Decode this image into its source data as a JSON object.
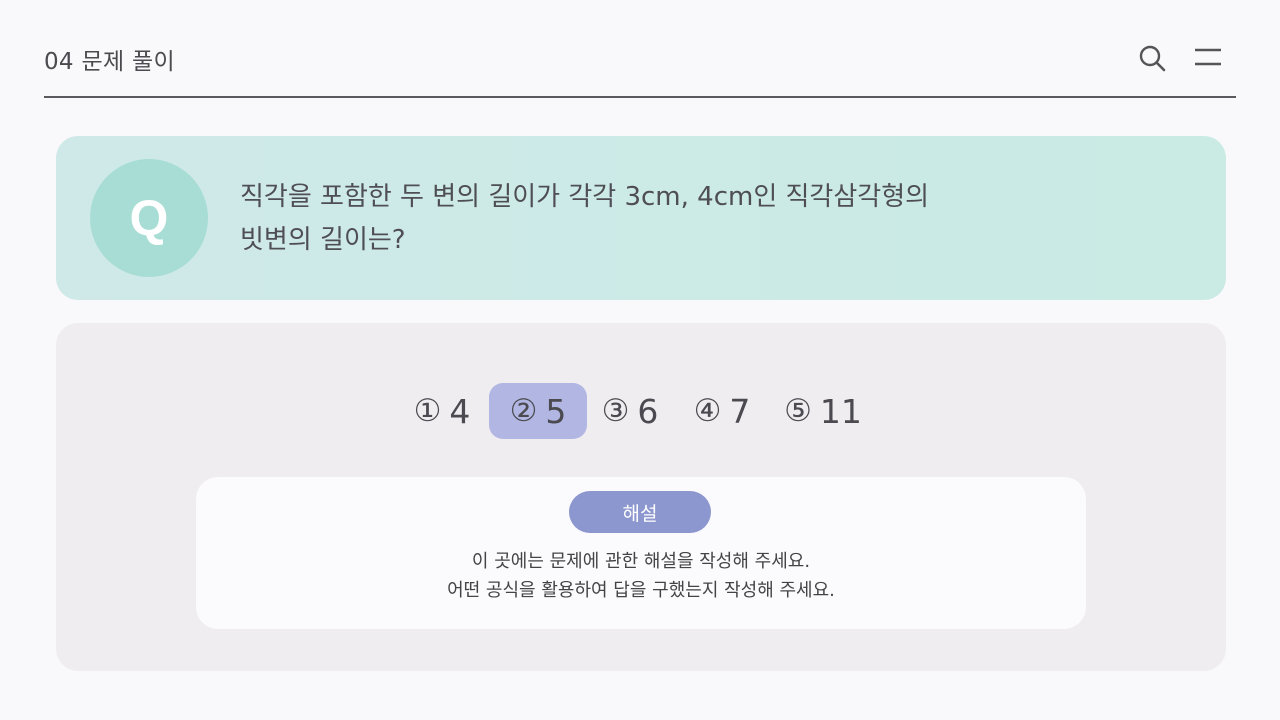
{
  "header": {
    "title": "04 문제 풀이",
    "search_icon": "search-icon",
    "menu_icon": "menu-icon"
  },
  "question": {
    "badge": "Q",
    "line1": "직각을 포함한 두 변의 길이가 각각 3cm, 4cm인 직각삼각형의",
    "line2": "빗변의 길이는?"
  },
  "choices": [
    {
      "marker": "①",
      "value": "4",
      "selected": false
    },
    {
      "marker": "②",
      "value": "5",
      "selected": true
    },
    {
      "marker": "③",
      "value": "6",
      "selected": false
    },
    {
      "marker": "④",
      "value": "7",
      "selected": false
    },
    {
      "marker": "⑤",
      "value": "11",
      "selected": false
    }
  ],
  "explanation": {
    "button_label": "해설",
    "line1": "이 곳에는 문제에 관한 해설을 작성해 주세요.",
    "line2": "어떤 공식을 활용하여 답을 구했는지 작성해 주세요."
  },
  "colors": {
    "question_bg": "#cfe9e9",
    "q_badge": "#a8ddd5",
    "selected_choice": "#b2b6e2",
    "explain_button": "#8c96cf",
    "panel_bg": "#efedf0"
  }
}
